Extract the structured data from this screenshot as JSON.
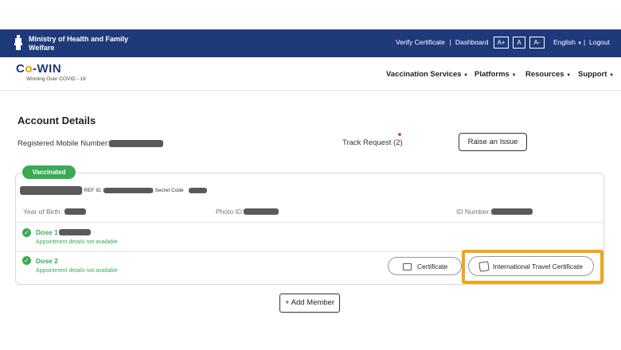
{
  "header": {
    "ministry_line1": "Ministry of Health and Family",
    "ministry_line2": "Welfare",
    "verify_certificate": "Verify Certificate",
    "separator": "|",
    "dashboard": "Dashboard",
    "font_increase": "A+",
    "font_normal": "A",
    "font_decrease": "A-",
    "language": "English",
    "logout": "Logout"
  },
  "navbar": {
    "logo_prefix": "C",
    "logo_o": "o",
    "logo_suffix": "-WIN",
    "tagline": "Winning Over COVID - 19",
    "items": [
      {
        "label": "Vaccination Services"
      },
      {
        "label": "Platforms"
      },
      {
        "label": "Resources"
      },
      {
        "label": "Support"
      }
    ]
  },
  "account": {
    "title": "Account Details",
    "registered_mobile_label": "Registered Mobile Number:",
    "track_request_label": "Track Request (2)",
    "raise_issue_label": "Raise an Issue"
  },
  "member": {
    "status_badge": "Vaccinated",
    "ref_id_label": "| REF ID :",
    "secret_code_label": "| Secret Code",
    "year_of_birth_label": "Year of Birth:",
    "photo_id_label": "Photo ID:",
    "id_number_label": "ID Number:",
    "doses": [
      {
        "label": "Dose 1",
        "appointment": "Appointment details not available"
      },
      {
        "label": "Dose 2",
        "appointment": "Appointment details not available"
      }
    ],
    "certificate_button": "Certificate",
    "international_certificate_button": "International Travel Certificate"
  },
  "add_member_label": "+ Add Member",
  "colors": {
    "header_bg": "#1f3a7a",
    "vaccinated_green": "#3aaa55",
    "highlight_orange": "#f0a618"
  }
}
